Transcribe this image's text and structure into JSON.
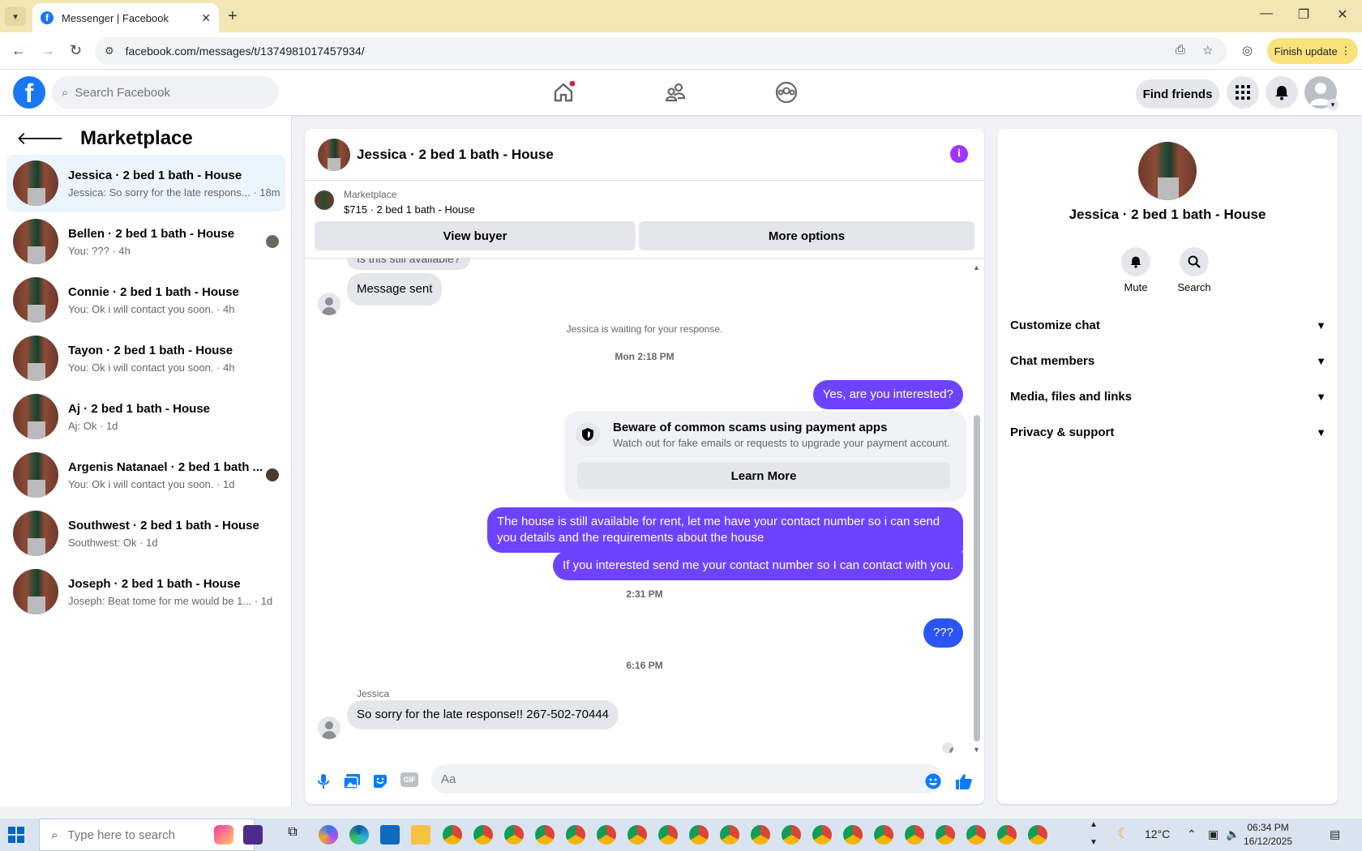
{
  "browser": {
    "tab_title": "Messenger | Facebook",
    "url": "facebook.com/messages/t/1374981017457934/",
    "finish_update": "Finish update"
  },
  "fb": {
    "logo": "f",
    "search_placeholder": "Search Facebook",
    "find_friends": "Find friends"
  },
  "left": {
    "title": "Marketplace",
    "conversations": [
      {
        "name": "Jessica · 2 bed 1 bath - House",
        "snippet": "Jessica: So sorry for the late respons... · 18m",
        "active": true
      },
      {
        "name": "Bellen · 2 bed 1 bath - House",
        "snippet": "You: ??? · 4h"
      },
      {
        "name": "Connie · 2 bed 1 bath - House",
        "snippet": "You: Ok i will contact you soon. · 4h"
      },
      {
        "name": "Tayon · 2 bed 1 bath - House",
        "snippet": "You: Ok i will contact you soon. · 4h"
      },
      {
        "name": "Aj · 2 bed 1 bath - House",
        "snippet": "Aj: Ok · 1d"
      },
      {
        "name": "Argenis Natanael · 2 bed 1 bath ...",
        "snippet": "You: Ok i will contact you soon. · 1d"
      },
      {
        "name": "Southwest · 2 bed 1 bath - House",
        "snippet": "Southwest: Ok · 1d"
      },
      {
        "name": "Joseph · 2 bed 1 bath - House",
        "snippet": "Joseph: Beat tome for me would be 1... · 1d"
      }
    ]
  },
  "chat": {
    "title": "Jessica · 2 bed 1 bath - House",
    "listing_category": "Marketplace",
    "listing_price": "$715 · 2 bed 1 bath - House",
    "view_buyer": "View buyer",
    "more_options": "More options",
    "partial_msg": "Is this still available?",
    "msg_sent": "Message sent",
    "waiting": "Jessica is waiting for your response.",
    "ts1": "Mon 2:18 PM",
    "out1": "Yes, are you interested?",
    "scam_title": "Beware of common scams using payment apps",
    "scam_body": "Watch out for fake emails or requests to upgrade your payment account.",
    "learn_more": "Learn More",
    "out2": "The house is still available for rent, let me have your contact number so i can send you details and the requirements about the house",
    "out3": "If you interested send me your contact number so I can contact with you.",
    "ts2": "2:31 PM",
    "out4": "???",
    "ts3": "6:16 PM",
    "sender": "Jessica",
    "in1": "So sorry for the late response!! 267-502-70444",
    "composer_placeholder": "Aa",
    "gif": "GIF"
  },
  "right": {
    "name": "Jessica · 2 bed 1 bath - House",
    "mute": "Mute",
    "search": "Search",
    "rows": [
      "Customize chat",
      "Chat members",
      "Media, files and links",
      "Privacy & support"
    ]
  },
  "taskbar": {
    "search_placeholder": "Type here to search",
    "temp": "12°C",
    "time": "06:34 PM",
    "date": "16/12/2025"
  },
  "colors": {
    "fb_blue": "#1877f2",
    "outgoing_bubble": "#6e43ff",
    "active_convo": "#ebf5ff"
  }
}
